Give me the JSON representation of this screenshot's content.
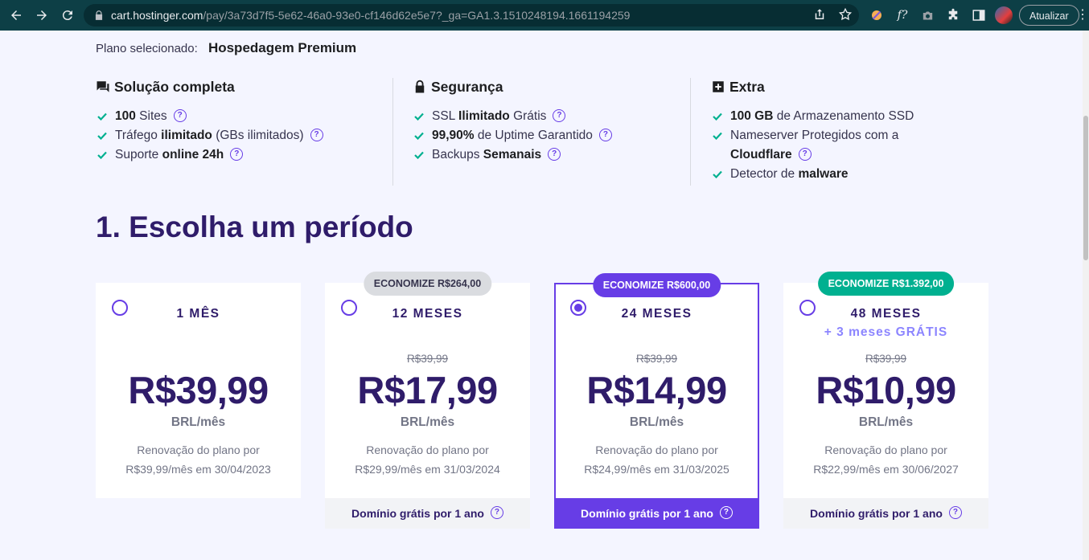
{
  "browser": {
    "url_host": "cart.hostinger.com",
    "url_path": "/pay/3a73d7f5-5e62-46a0-93e0-cf146d62e5e7?_ga=GA1.3.1510248194.1661194259",
    "update_label": "Atualizar",
    "fx_ext_label": "f?"
  },
  "plan": {
    "label": "Plano selecionado:",
    "name": "Hospedagem Premium"
  },
  "features": [
    {
      "icon": "chat-icon",
      "title": "Solução completa",
      "items": [
        {
          "bold": "100",
          "text": " Sites",
          "pre": ""
        },
        {
          "pre": "Tráfego ",
          "bold": "ilimitado",
          "text": " (GBs ilimitados)"
        },
        {
          "pre": "Suporte ",
          "bold": "online 24h",
          "text": ""
        }
      ]
    },
    {
      "icon": "lock-icon",
      "title": "Segurança",
      "items": [
        {
          "pre": "SSL ",
          "bold": "Ilimitado",
          "text": " Grátis"
        },
        {
          "pre": "",
          "bold": "99,90%",
          "text": " de Uptime Garantido"
        },
        {
          "pre": "Backups ",
          "bold": "Semanais",
          "text": ""
        }
      ]
    },
    {
      "icon": "plus-box-icon",
      "title": "Extra",
      "items": [
        {
          "pre": "",
          "bold": "100 GB",
          "text": " de Armazenamento SSD"
        },
        {
          "pre": "Nameserver Protegidos com a",
          "bold": "Cloudflare",
          "text": ""
        },
        {
          "pre": "Detector de ",
          "bold": "malware",
          "text": ""
        }
      ]
    }
  ],
  "heading": "1. Escolha um período",
  "periods": [
    {
      "term": "1 MÊS",
      "bonus": "",
      "badge": "",
      "old_price": "",
      "price": "R$39,99",
      "unit": "BRL/mês",
      "renew_line1": "Renovação do plano por",
      "renew_line2": "R$39,99/mês em 30/04/2023",
      "footer": ""
    },
    {
      "term": "12 MESES",
      "bonus": "",
      "badge": "ECONOMIZE R$264,00",
      "old_price": "R$39,99",
      "price": "R$17,99",
      "unit": "BRL/mês",
      "renew_line1": "Renovação do plano por",
      "renew_line2": "R$29,99/mês em 31/03/2024",
      "footer": "Domínio grátis por 1 ano"
    },
    {
      "term": "24 MESES",
      "bonus": "",
      "badge": "ECONOMIZE R$600,00",
      "old_price": "R$39,99",
      "price": "R$14,99",
      "unit": "BRL/mês",
      "renew_line1": "Renovação do plano por",
      "renew_line2": "R$24,99/mês em 31/03/2025",
      "footer": "Domínio grátis por 1 ano",
      "selected": true
    },
    {
      "term": "48 MESES",
      "bonus": "+ 3 meses GRÁTIS",
      "badge": "ECONOMIZE R$1.392,00",
      "old_price": "R$39,99",
      "price": "R$10,99",
      "unit": "BRL/mês",
      "renew_line1": "Renovação do plano por",
      "renew_line2": "R$22,99/mês em 30/06/2027",
      "footer": "Domínio grátis por 1 ano"
    }
  ],
  "colors": {
    "accent": "#673de6",
    "heading": "#2f1c6a",
    "check": "#00b090",
    "badge_green": "#00b090",
    "badge_grey": "#dadce0",
    "browser_bar": "#0d3f46",
    "page_bg": "#f4f5ff"
  }
}
